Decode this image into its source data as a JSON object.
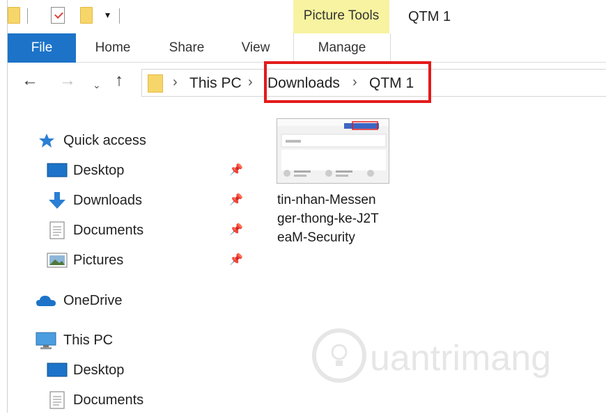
{
  "window": {
    "title": "QTM 1",
    "contextual_group": "Picture Tools"
  },
  "ribbon": {
    "tabs": [
      {
        "label": "File",
        "active": true
      },
      {
        "label": "Home"
      },
      {
        "label": "Share"
      },
      {
        "label": "View"
      },
      {
        "label": "Manage",
        "contextual": true
      }
    ]
  },
  "address_bar": {
    "crumbs": [
      "This PC",
      "Downloads",
      "QTM 1"
    ],
    "separator": ">"
  },
  "nav_pane": {
    "quick_access": {
      "label": "Quick access",
      "icon": "star-icon"
    },
    "quick_items": [
      {
        "label": "Desktop",
        "icon": "desktop-icon",
        "pinned": true
      },
      {
        "label": "Downloads",
        "icon": "download-arrow-icon",
        "pinned": true
      },
      {
        "label": "Documents",
        "icon": "document-icon",
        "pinned": true
      },
      {
        "label": "Pictures",
        "icon": "pictures-icon",
        "pinned": true
      }
    ],
    "onedrive": {
      "label": "OneDrive",
      "icon": "cloud-icon"
    },
    "this_pc": {
      "label": "This PC",
      "icon": "monitor-icon"
    },
    "pc_items": [
      {
        "label": "Desktop",
        "icon": "desktop-icon"
      },
      {
        "label": "Documents",
        "icon": "document-icon"
      }
    ]
  },
  "content": {
    "files": [
      {
        "name_lines": [
          "tin-nhan-Messen",
          "ger-thong-ke-J2T",
          "eaM-Security"
        ]
      }
    ]
  },
  "colors": {
    "file_tab": "#1c73c8",
    "contextual_tab": "#f7f3a0",
    "highlight": "#e31a1a",
    "folder": "#f6d66b"
  }
}
